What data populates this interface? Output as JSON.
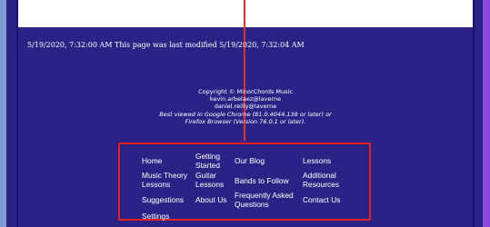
{
  "modified_text": "5/19/2020, 7:32:00 AM This page was last modified 5/19/2020, 7:32:04 AM",
  "footer": {
    "copyright": "Copyright © MinorChords Music",
    "email1": "kevin.arbelaez@laverne",
    "email2": "daniel.reilly@laverne",
    "browser_line1": "Best viewed in Google Chrome (81.0.4044.138 or later) or",
    "browser_line2": "Firefox Browser (Version 76.0.1 or later)."
  },
  "nav": {
    "home": "Home",
    "getting_started_1": "Getting",
    "getting_started_2": "Started",
    "our_blog": "Our Blog",
    "lessons": "Lessons",
    "music_theory_1": "Music Theory",
    "music_theory_2": "Lessons",
    "guitar_lessons_1": "Guitar",
    "guitar_lessons_2": "Lessons",
    "bands_to_follow": "Bands to Follow",
    "additional_resources_1": "Additional",
    "additional_resources_2": "Resources",
    "suggestions": "Suggestions",
    "about_us": "About Us",
    "faq_1": "Frequently Asked",
    "faq_2": "Questions",
    "contact_us": "Contact Us",
    "settings": "Settings"
  },
  "colors": {
    "background": "#2a2385",
    "highlight_border": "#e02020",
    "text": "#ffffff"
  }
}
